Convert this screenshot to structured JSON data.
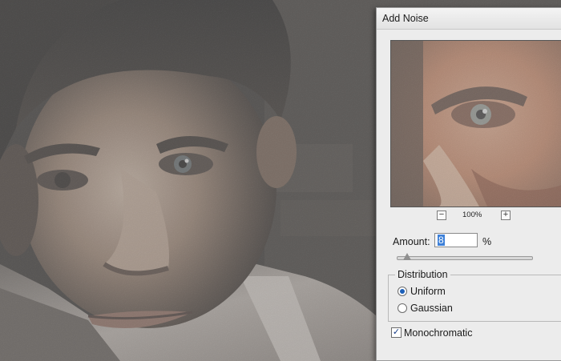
{
  "dialog": {
    "title": "Add Noise",
    "zoom": {
      "minus_icon": "minus-icon",
      "plus_icon": "plus-icon",
      "level": "100%"
    },
    "amount": {
      "label": "Amount:",
      "value": "8",
      "unit": "%",
      "slider_fraction": 0.08
    },
    "distribution": {
      "legend": "Distribution",
      "options": [
        {
          "label": "Uniform",
          "selected": true
        },
        {
          "label": "Gaussian",
          "selected": false
        }
      ]
    },
    "monochromatic": {
      "label": "Monochromatic",
      "checked": true
    }
  },
  "colors": {
    "dialog_bg": "#ececec",
    "accent_selection": "#3d80d8",
    "radio_dot": "#1c5fb8"
  }
}
